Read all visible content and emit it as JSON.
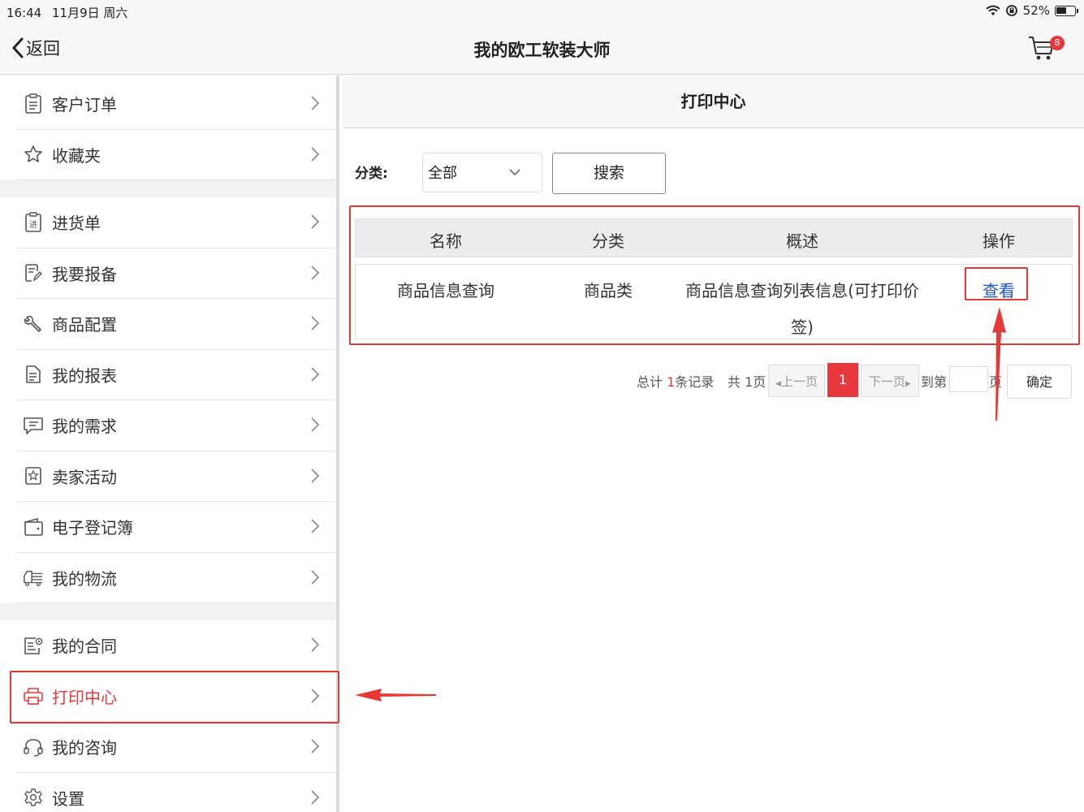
{
  "status_bar": {
    "time": "16:44",
    "date": "11月9日 周六",
    "battery": "52%"
  },
  "nav": {
    "back_label": "返回",
    "title": "我的欧工软装大师",
    "cart_badge": "8"
  },
  "sidebar": {
    "groups": [
      [
        {
          "label": "客户订单",
          "icon": "clipboard-icon"
        },
        {
          "label": "收藏夹",
          "icon": "star-icon"
        }
      ],
      [
        {
          "label": "进货单",
          "icon": "purchase-order-icon"
        },
        {
          "label": "我要报备",
          "icon": "report-edit-icon"
        },
        {
          "label": "商品配置",
          "icon": "wrench-icon"
        },
        {
          "label": "我的报表",
          "icon": "document-icon"
        },
        {
          "label": "我的需求",
          "icon": "chat-icon"
        },
        {
          "label": "卖家活动",
          "icon": "badge-icon"
        },
        {
          "label": "电子登记簿",
          "icon": "wallet-icon"
        },
        {
          "label": "我的物流",
          "icon": "truck-icon"
        }
      ],
      [
        {
          "label": "我的合同",
          "icon": "contract-icon"
        },
        {
          "label": "打印中心",
          "icon": "printer-icon",
          "active": true
        },
        {
          "label": "我的咨询",
          "icon": "headset-icon"
        },
        {
          "label": "设置",
          "icon": "gear-icon"
        }
      ]
    ]
  },
  "main": {
    "header": "打印中心",
    "filter": {
      "label": "分类:",
      "selected": "全部",
      "search_label": "搜索"
    },
    "table": {
      "headers": [
        "名称",
        "分类",
        "概述",
        "操作"
      ],
      "rows": [
        {
          "name": "商品信息查询",
          "category": "商品类",
          "summary": "商品信息查询列表信息(可打印价签)",
          "action": "查看"
        }
      ]
    },
    "pagination": {
      "total_prefix": "总计 ",
      "total_count": "1",
      "total_suffix": "条记录",
      "pages_text": "共 1页",
      "prev_label": "上一页",
      "current_page": "1",
      "next_label": "下一页",
      "goto_label": "到第",
      "page_suffix": "页",
      "confirm_label": "确定"
    }
  },
  "colors": {
    "accent": "#e8383d",
    "link": "#1f56c6",
    "annotation": "#e53935"
  }
}
